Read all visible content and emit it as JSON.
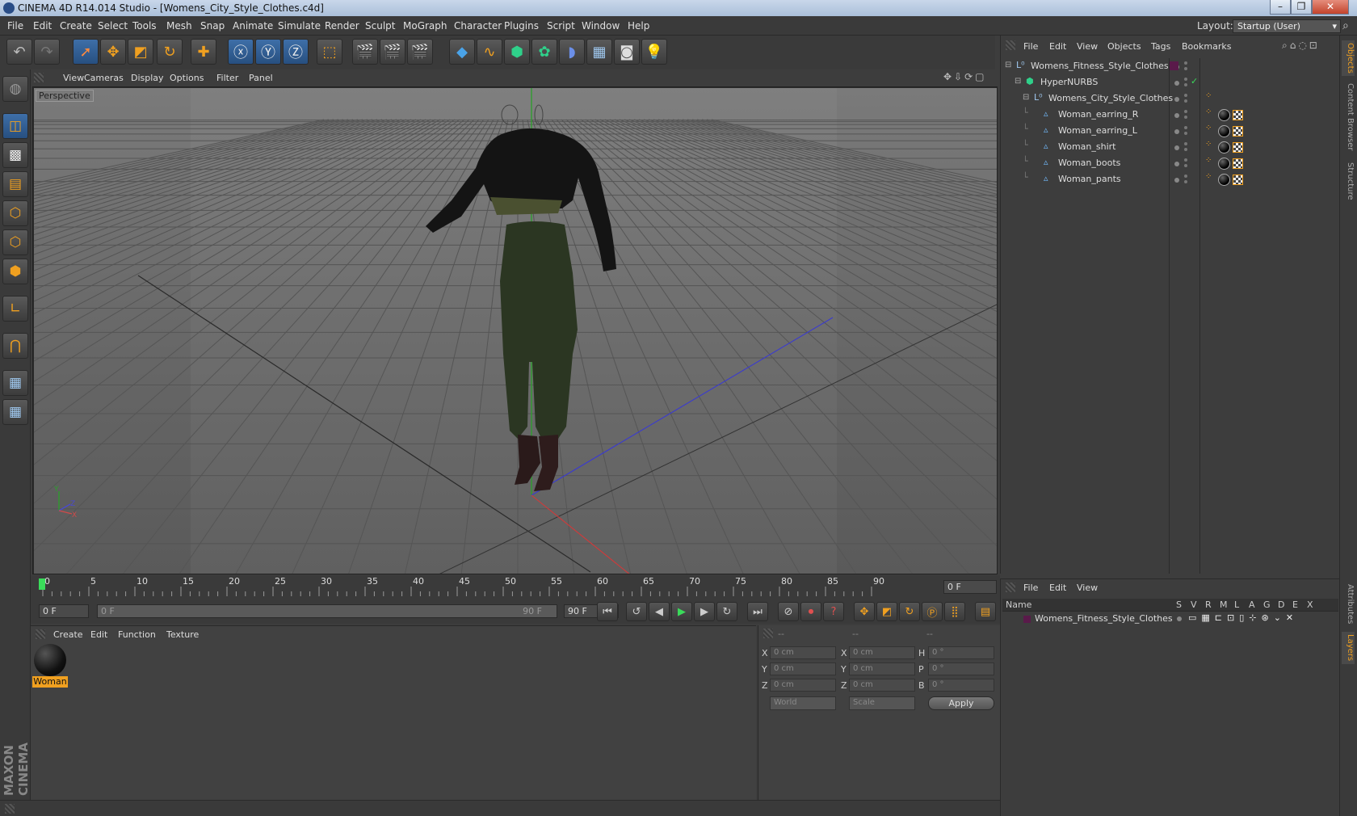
{
  "window": {
    "title": "CINEMA 4D R14.014 Studio - [Womens_City_Style_Clothes.c4d]"
  },
  "menu": [
    "File",
    "Edit",
    "Create",
    "Select",
    "Tools",
    "Mesh",
    "Snap",
    "Animate",
    "Simulate",
    "Render",
    "Sculpt",
    "MoGraph",
    "Character",
    "Plugins",
    "Script",
    "Window",
    "Help"
  ],
  "layout": {
    "label": "Layout:",
    "value": "Startup (User)"
  },
  "viewport": {
    "menu": [
      "View",
      "Cameras",
      "Display",
      "Options",
      "Filter",
      "Panel"
    ],
    "label": "Perspective",
    "axis": {
      "y": "Y",
      "z": "Z",
      "x": "X"
    }
  },
  "timeline": {
    "ticks": [
      "0",
      "5",
      "10",
      "15",
      "20",
      "25",
      "30",
      "35",
      "40",
      "45",
      "50",
      "55",
      "60",
      "65",
      "70",
      "75",
      "80",
      "85",
      "90"
    ],
    "current_frame": "0 F",
    "start_field": "0 F",
    "range_start": "0 F",
    "range_end": "90 F",
    "end_field": "90 F"
  },
  "materials": {
    "menu": [
      "Create",
      "Edit",
      "Function",
      "Texture"
    ],
    "items": [
      {
        "name": "Woman"
      }
    ]
  },
  "coords": {
    "headers": [
      "--",
      "--",
      "--"
    ],
    "rows": [
      {
        "a": "X",
        "av": "0 cm",
        "b": "X",
        "bv": "0 cm",
        "c": "H",
        "cv": "0 °"
      },
      {
        "a": "Y",
        "av": "0 cm",
        "b": "Y",
        "bv": "0 cm",
        "c": "P",
        "cv": "0 °"
      },
      {
        "a": "Z",
        "av": "0 cm",
        "b": "Z",
        "bv": "0 cm",
        "c": "B",
        "cv": "0 °"
      }
    ],
    "space": "World",
    "mode": "Scale",
    "apply": "Apply"
  },
  "objects": {
    "menu": [
      "File",
      "Edit",
      "View",
      "Objects",
      "Tags",
      "Bookmarks"
    ],
    "tree": [
      {
        "name": "Womens_Fitness_Style_Clothes",
        "icon": "null-icon"
      },
      {
        "name": "HyperNURBS",
        "icon": "hypernurbs-icon"
      },
      {
        "name": "Womens_City_Style_Clothes",
        "icon": "null-icon"
      },
      {
        "name": "Woman_earring_R",
        "icon": "polygon-icon"
      },
      {
        "name": "Woman_earring_L",
        "icon": "polygon-icon"
      },
      {
        "name": "Woman_shirt",
        "icon": "polygon-icon"
      },
      {
        "name": "Woman_boots",
        "icon": "polygon-icon"
      },
      {
        "name": "Woman_pants",
        "icon": "polygon-icon"
      }
    ]
  },
  "layers": {
    "menu": [
      "File",
      "Edit",
      "View"
    ],
    "columns": [
      "Name",
      "S",
      "V",
      "R",
      "M",
      "L",
      "A",
      "G",
      "D",
      "E",
      "X"
    ],
    "rows": [
      {
        "name": "Womens_Fitness_Style_Clothes"
      }
    ]
  },
  "sidetabs": [
    "Objects",
    "Content Browser",
    "Structure",
    "Attributes",
    "Layers"
  ],
  "brand": "MAXON CINEMA 4D",
  "colors": {
    "accent": "#f0a020",
    "selection": "#3e6fa8",
    "layer_color": "#5a1a4a"
  }
}
